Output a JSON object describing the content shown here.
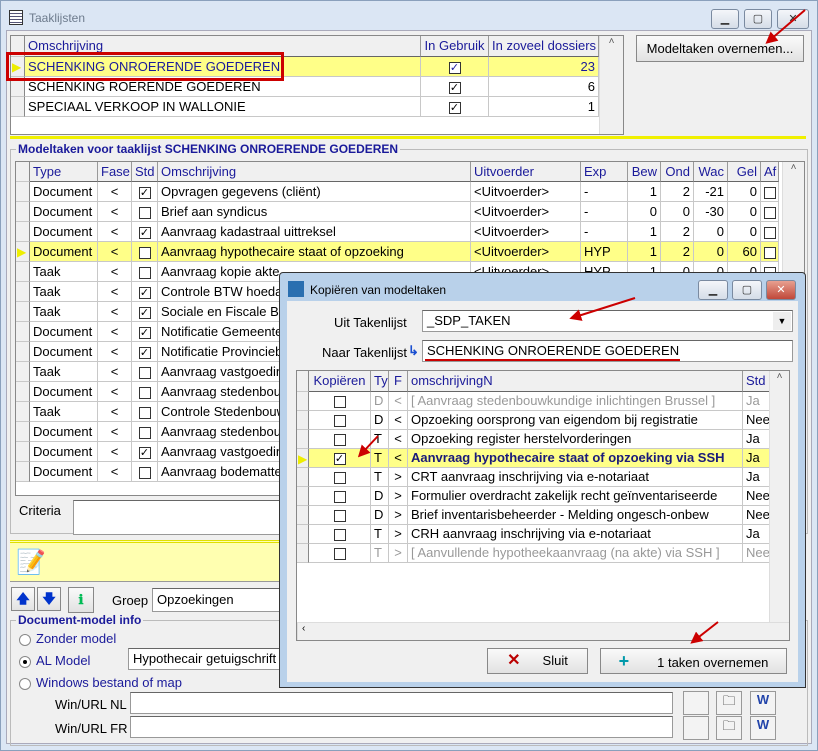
{
  "window": {
    "title": "Taaklijsten"
  },
  "tasklists": {
    "headers": [
      "Omschrijving",
      "In Gebruik",
      "In zoveel dossiers"
    ],
    "rows": [
      {
        "name": "SCHENKING ONROERENDE GOEDEREN",
        "in_use": true,
        "count": "23",
        "selected": true
      },
      {
        "name": "SCHENKING ROERENDE GOEDEREN",
        "in_use": true,
        "count": "6"
      },
      {
        "name": "SPECIAAL VERKOOP IN WALLONIE",
        "in_use": true,
        "count": "1"
      }
    ],
    "take_over_button": "Modeltaken overnemen..."
  },
  "modeltasks": {
    "group_title": "Modeltaken voor taaklijst SCHENKING ONROERENDE GOEDEREN",
    "headers": [
      "Type",
      "Fase",
      "Std",
      "Omschrijving",
      "Uitvoerder",
      "Exp",
      "Bew",
      "Ond",
      "Wac",
      "Gel",
      "Af"
    ],
    "rows": [
      {
        "type": "Document",
        "fase": "<",
        "std": true,
        "desc": "Opvragen gegevens (cliënt)",
        "uit": "<Uitvoerder>",
        "exp": "-",
        "bew": "1",
        "ond": "2",
        "wac": "-21",
        "gel": "0",
        "af": false
      },
      {
        "type": "Document",
        "fase": "<",
        "std": false,
        "desc": "Brief aan syndicus",
        "uit": "<Uitvoerder>",
        "exp": "-",
        "bew": "0",
        "ond": "0",
        "wac": "-30",
        "gel": "0",
        "af": false
      },
      {
        "type": "Document",
        "fase": "<",
        "std": true,
        "desc": "Aanvraag kadastraal uittreksel",
        "uit": "<Uitvoerder>",
        "exp": "-",
        "bew": "1",
        "ond": "2",
        "wac": "0",
        "gel": "0",
        "af": false
      },
      {
        "type": "Document",
        "fase": "<",
        "std": false,
        "desc": "Aanvraag hypothecaire staat of opzoeking",
        "uit": "<Uitvoerder>",
        "exp": "HYP",
        "bew": "1",
        "ond": "2",
        "wac": "0",
        "gel": "60",
        "af": false,
        "selected": true
      },
      {
        "type": "Taak",
        "fase": "<",
        "std": false,
        "desc": "Aanvraag kopie akte",
        "uit": "<Uitvoerder>",
        "exp": "HYP",
        "bew": "1",
        "ond": "0",
        "wac": "0",
        "gel": "0",
        "af": false
      },
      {
        "type": "Taak",
        "fase": "<",
        "std": true,
        "desc": "Controle BTW hoeda"
      },
      {
        "type": "Taak",
        "fase": "<",
        "std": true,
        "desc": "Sociale en Fiscale B"
      },
      {
        "type": "Document",
        "fase": "<",
        "std": true,
        "desc": "Notificatie Gemeente"
      },
      {
        "type": "Document",
        "fase": "<",
        "std": true,
        "desc": "Notificatie Provincieb"
      },
      {
        "type": "Taak",
        "fase": "<",
        "std": false,
        "desc": "Aanvraag vastgoedin"
      },
      {
        "type": "Document",
        "fase": "<",
        "std": false,
        "desc": "Aanvraag stedenbouw"
      },
      {
        "type": "Taak",
        "fase": "<",
        "std": false,
        "desc": "Controle Stedenbouw"
      },
      {
        "type": "Document",
        "fase": "<",
        "std": false,
        "desc": "Aanvraag stedenbouw"
      },
      {
        "type": "Document",
        "fase": "<",
        "std": true,
        "desc": "Aanvraag vastgoedin"
      },
      {
        "type": "Document",
        "fase": "<",
        "std": false,
        "desc": "Aanvraag bodematte"
      }
    ]
  },
  "criteria": {
    "label": "Criteria",
    "value": ""
  },
  "toolbar": {
    "group_label": "Groep",
    "group_value": "Opzoekingen"
  },
  "docmodel": {
    "title": "Document-model info",
    "options": [
      "Zonder model",
      "AL Model",
      "Windows bestand of map"
    ],
    "selected": "AL Model",
    "al_model_value": "Hypothecair getuigschrift",
    "url_nl_label": "Win/URL NL",
    "url_nl_value": "",
    "url_fr_label": "Win/URL FR",
    "url_fr_value": ""
  },
  "dialog": {
    "title": "Kopiëren van modeltaken",
    "from_label": "Uit Takenlijst",
    "from_value": "_SDP_TAKEN",
    "to_label": "Naar Takenlijst",
    "to_value": "SCHENKING ONROERENDE GOEDEREN",
    "headers": [
      "Kopiëren",
      "Ty",
      "F",
      "omschrijvingN",
      "Std"
    ],
    "rows": [
      {
        "copy": false,
        "ty": "D",
        "f": "<",
        "desc": "[ Aanvraag stedenbouwkundige inlichtingen Brussel ]",
        "std": "Ja",
        "disabled": true
      },
      {
        "copy": false,
        "ty": "D",
        "f": "<",
        "desc": "Opzoeking oorsprong van eigendom bij registratie",
        "std": "Nee"
      },
      {
        "copy": false,
        "ty": "T",
        "f": "<",
        "desc": "Opzoeking register herstelvorderingen",
        "std": "Ja"
      },
      {
        "copy": true,
        "ty": "T",
        "f": "<",
        "desc": "Aanvraag hypothecaire staat of opzoeking via SSH",
        "std": "Ja",
        "selected": true
      },
      {
        "copy": false,
        "ty": "T",
        "f": ">",
        "desc": "CRT aanvraag inschrijving via e-notariaat",
        "std": "Ja"
      },
      {
        "copy": false,
        "ty": "D",
        "f": ">",
        "desc": "Formulier overdracht zakelijk recht geïnventariseerde",
        "std": "Nee"
      },
      {
        "copy": false,
        "ty": "D",
        "f": ">",
        "desc": "Brief inventarisbeheerder - Melding ongesch-onbew",
        "std": "Nee"
      },
      {
        "copy": false,
        "ty": "T",
        "f": ">",
        "desc": "CRH aanvraag inschrijving via e-notariaat",
        "std": "Ja"
      },
      {
        "copy": false,
        "ty": "T",
        "f": ">",
        "desc": "[ Aanvullende hypotheekaanvraag (na akte) via SSH ]",
        "std": "Nee",
        "disabled": true
      }
    ],
    "close_button": "Sluit",
    "take_button": "1 taken overnemen"
  },
  "colors": {
    "selected_row": "#ffff88",
    "header_text": "#1a1a9a",
    "annotation": "#cc0000"
  }
}
